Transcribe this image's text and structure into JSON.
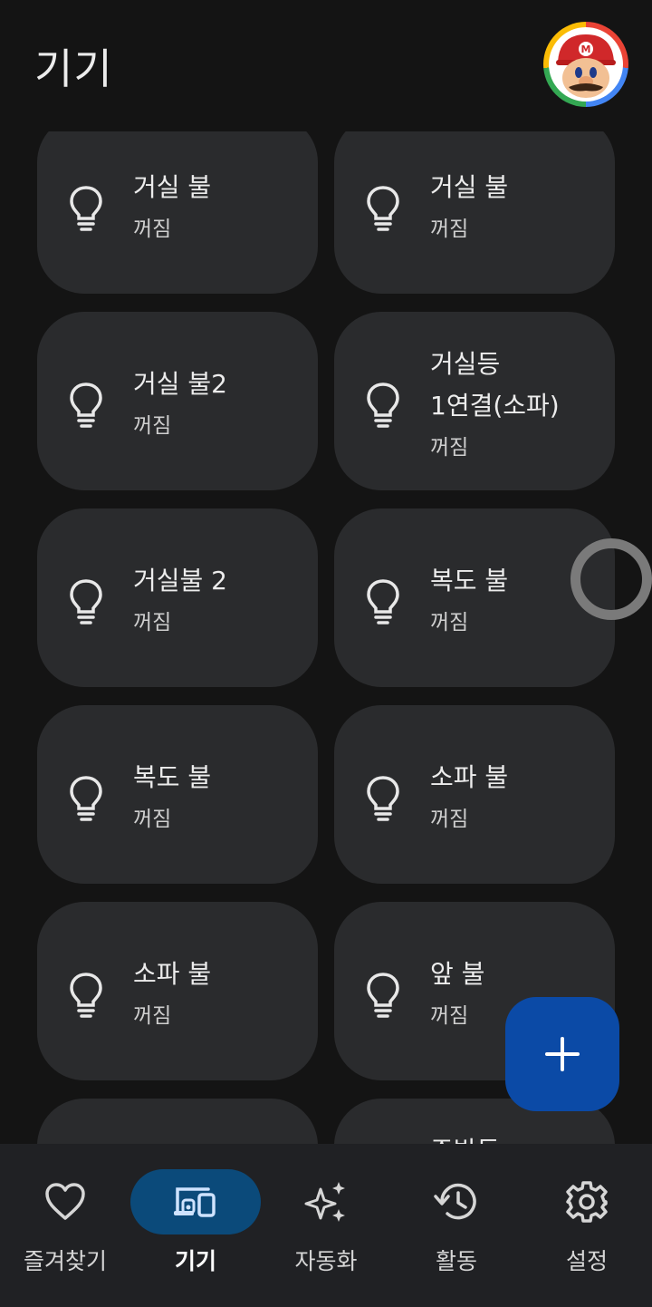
{
  "header": {
    "title": "기기"
  },
  "devices": [
    {
      "name": "거실 불",
      "status": "꺼짐"
    },
    {
      "name": "거실 불",
      "status": "꺼짐"
    },
    {
      "name": "거실 불2",
      "status": "꺼짐"
    },
    {
      "name": "거실등",
      "name2": "1연결(소파)",
      "status": "꺼짐"
    },
    {
      "name": "거실불 2",
      "status": "꺼짐"
    },
    {
      "name": "복도 불",
      "status": "꺼짐"
    },
    {
      "name": "복도 불",
      "status": "꺼짐"
    },
    {
      "name": "소파 불",
      "status": "꺼짐"
    },
    {
      "name": "소파 불",
      "status": "꺼짐"
    },
    {
      "name": "앞 불",
      "status": "꺼짐"
    },
    {
      "name": "",
      "status": ""
    },
    {
      "name": "주방등",
      "status": ""
    }
  ],
  "bottom_nav": [
    {
      "label": "즐겨찾기",
      "icon": "heart-icon",
      "active": false
    },
    {
      "label": "기기",
      "icon": "devices-icon",
      "active": true
    },
    {
      "label": "자동화",
      "icon": "sparkle-icon",
      "active": false
    },
    {
      "label": "활동",
      "icon": "history-icon",
      "active": false
    },
    {
      "label": "설정",
      "icon": "gear-icon",
      "active": false
    }
  ],
  "colors": {
    "background": "#141414",
    "tile": "#2a2b2d",
    "fab": "#0b4aa6",
    "nav_active": "#0b4a7a",
    "nav_bar": "#202124"
  }
}
